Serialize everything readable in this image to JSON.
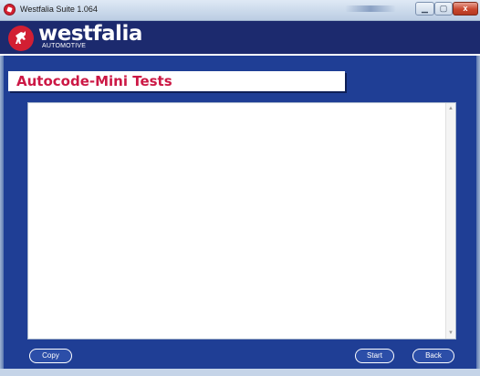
{
  "window": {
    "title": "Westfalia Suite 1.064",
    "controls": {
      "minimize_icon": "minimize-icon",
      "maximize_icon": "maximize-icon",
      "close_symbol": "x"
    }
  },
  "brand": {
    "name": "westfalia",
    "subtitle": "AUTOMOTIVE",
    "logo_icon": "horse-logo-icon",
    "colors": {
      "banner": "#1c2a6e",
      "logo_red": "#d21f33",
      "main_blue": "#1f3e95",
      "title_red": "#cc1845"
    }
  },
  "page": {
    "title": "Autocode-Mini Tests"
  },
  "output": {
    "text": ""
  },
  "buttons": {
    "copy": "Copy",
    "start": "Start",
    "back": "Back"
  }
}
